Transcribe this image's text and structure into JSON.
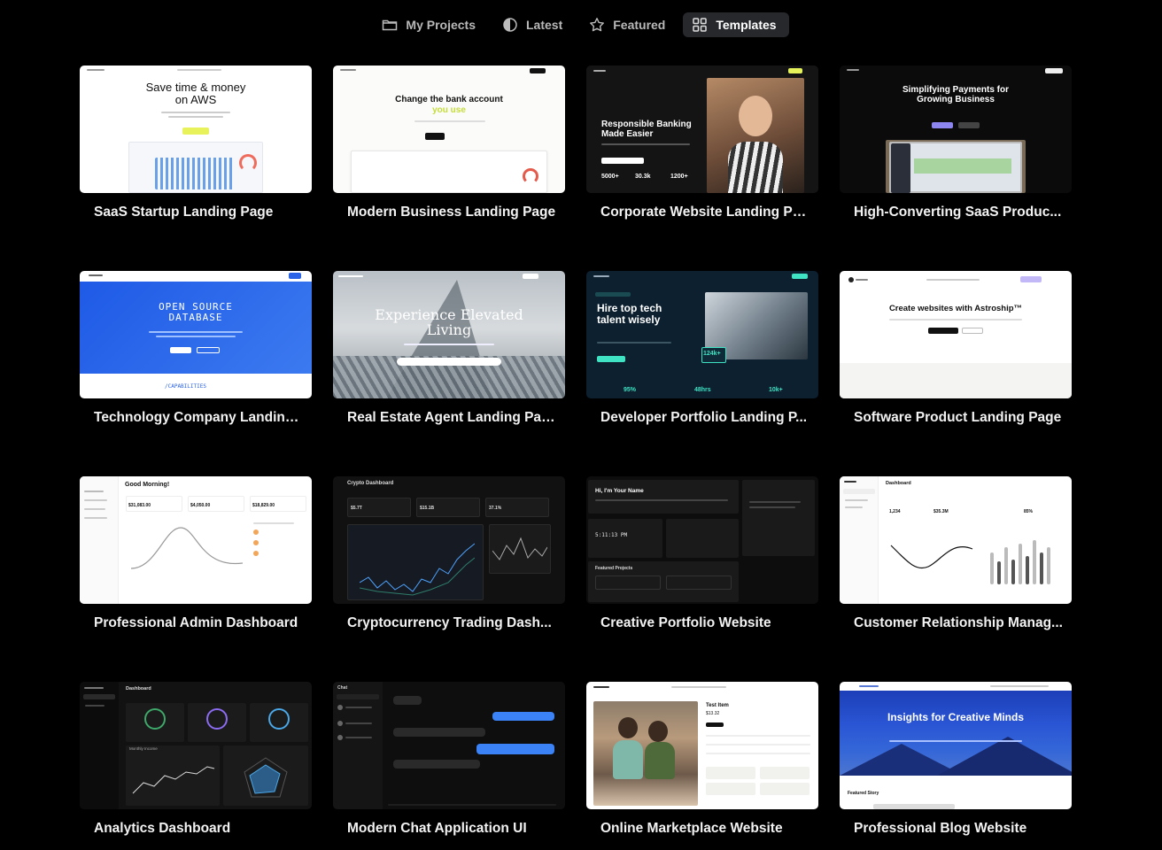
{
  "tabs": [
    {
      "label": "My Projects",
      "icon": "folder-icon",
      "active": false
    },
    {
      "label": "Latest",
      "icon": "half-circle-icon",
      "active": false
    },
    {
      "label": "Featured",
      "icon": "star-icon",
      "active": false
    },
    {
      "label": "Templates",
      "icon": "grid-icon",
      "active": true
    }
  ],
  "templates": [
    {
      "title": "SaaS Startup Landing Page",
      "preview": {
        "headline": "Save time & money on AWS"
      }
    },
    {
      "title": "Modern Business Landing Page",
      "preview": {
        "headline": "Change the bank account",
        "accent": "you use"
      }
    },
    {
      "title": "Corporate Website Landing Pa...",
      "preview": {
        "headline": "Responsible Banking Made Easier",
        "stats": [
          "5000+",
          "30.3k",
          "1200+"
        ]
      }
    },
    {
      "title": "High-Converting SaaS Produc...",
      "preview": {
        "headline": "Simplifying Payments for Growing Business"
      }
    },
    {
      "title": "Technology Company Landing...",
      "preview": {
        "headline": "OPEN SOURCE DATABASE",
        "footer": "/CAPABILITIES"
      }
    },
    {
      "title": "Real Estate Agent Landing Page",
      "preview": {
        "headline": "Experience Elevated Living"
      }
    },
    {
      "title": "Developer Portfolio Landing P...",
      "preview": {
        "headline": "Hire top tech talent wisely",
        "badge": "124k+",
        "stats": [
          "95%",
          "48hrs",
          "10k+"
        ]
      }
    },
    {
      "title": "Software Product Landing Page",
      "preview": {
        "headline": "Create websites with Astroship™"
      }
    },
    {
      "title": "Professional Admin Dashboard",
      "preview": {
        "headline": "Good Morning!",
        "stats": [
          "$31,083.00",
          "$4,050.00",
          "$18,829.00"
        ]
      }
    },
    {
      "title": "Cryptocurrency Trading Dash...",
      "preview": {
        "headline": "Crypto Dashboard",
        "stats": [
          "$5.7T",
          "$15.1B",
          "37.1%"
        ]
      }
    },
    {
      "title": "Creative Portfolio Website",
      "preview": {
        "headline": "Hi, I'm Your Name",
        "clock": "5:11:13 PM",
        "section": "Featured Projects"
      }
    },
    {
      "title": "Customer Relationship Manag...",
      "preview": {
        "headline": "Dashboard",
        "stats": [
          "1,234",
          "$35.3M",
          "85%"
        ]
      }
    },
    {
      "title": "Analytics Dashboard",
      "preview": {
        "headline": "Dashboard",
        "chart": "Monthly Income"
      }
    },
    {
      "title": "Modern Chat Application UI",
      "preview": {
        "headline": "Chat"
      }
    },
    {
      "title": "Online Marketplace Website",
      "preview": {
        "headline": "Test Item",
        "price": "$13.32"
      }
    },
    {
      "title": "Professional Blog Website",
      "preview": {
        "headline": "Insights for Creative Minds",
        "section": "Featured Story"
      }
    }
  ],
  "colors": {
    "background": "#000000",
    "tab_active_bg": "#26282c",
    "card_title": "#f2f2f2"
  }
}
